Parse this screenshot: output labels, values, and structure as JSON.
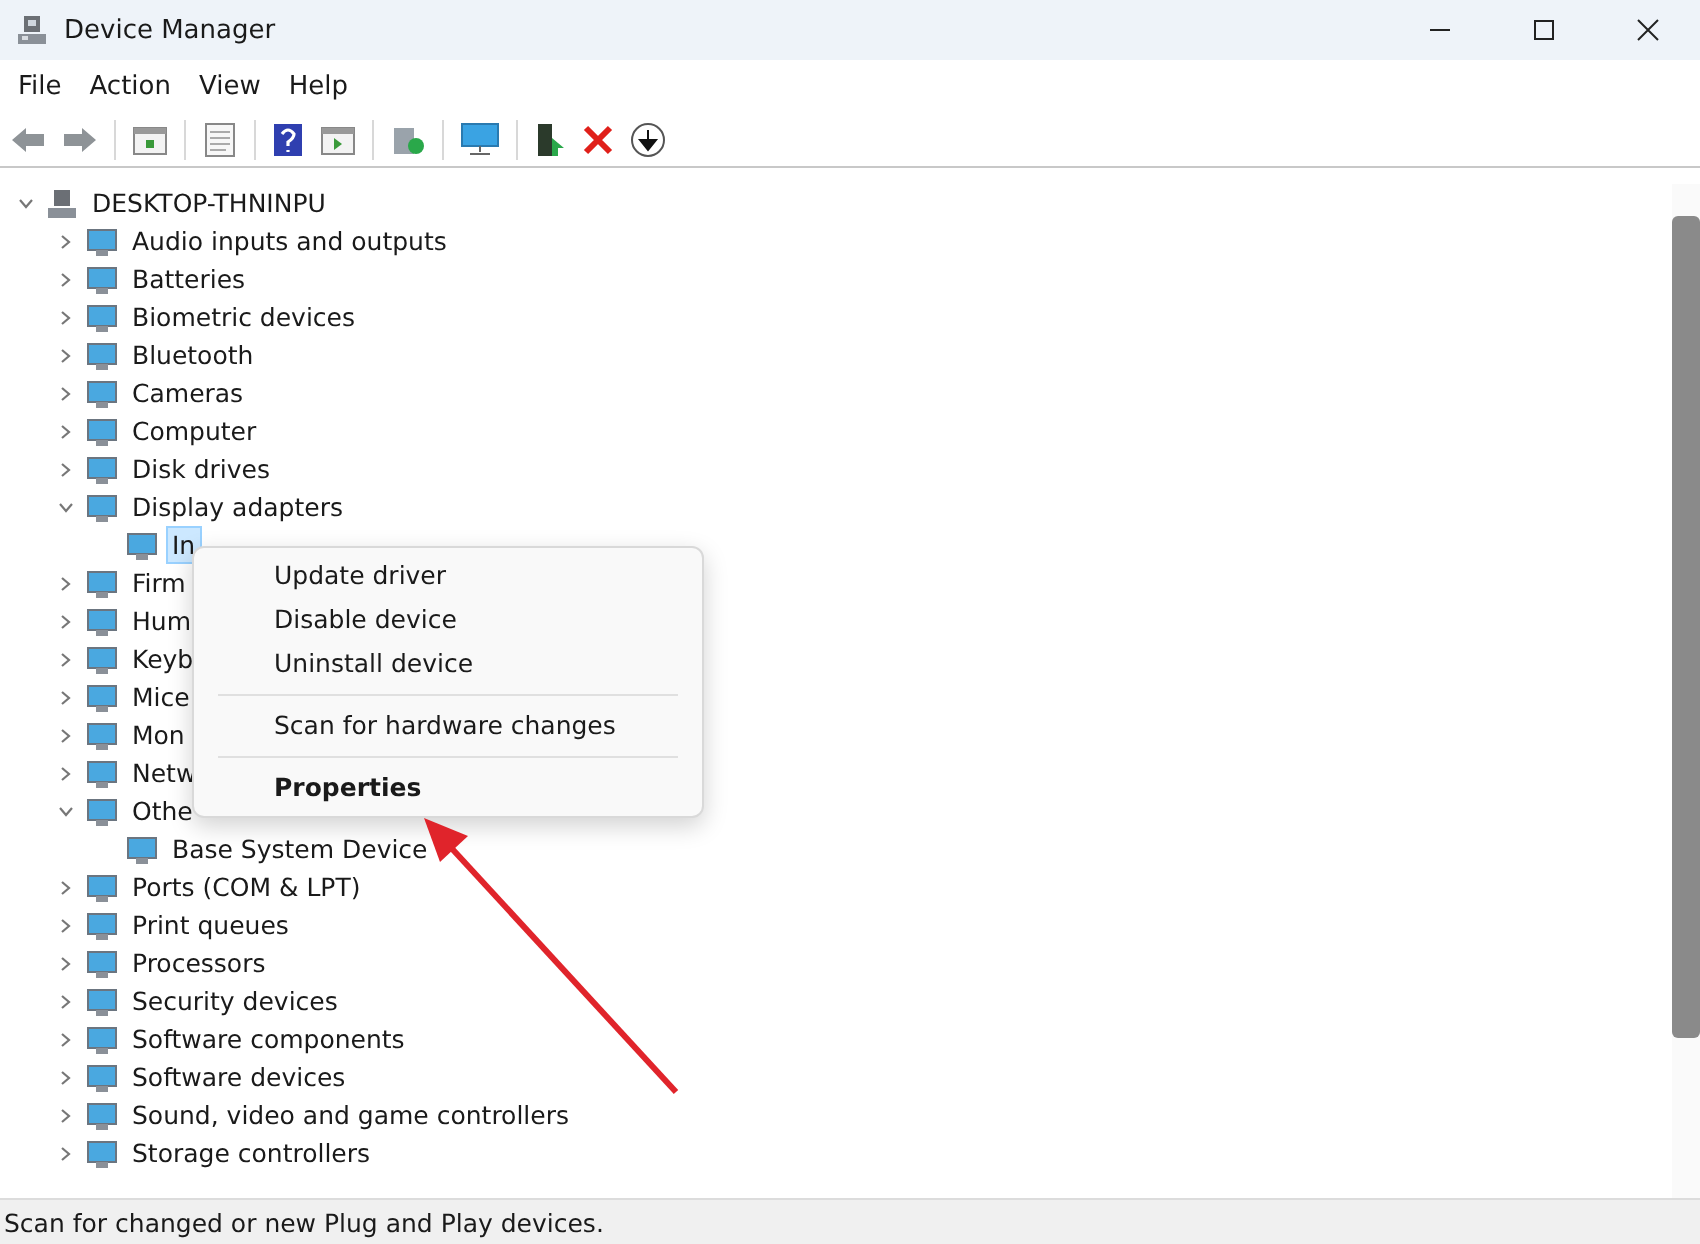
{
  "window": {
    "title": "Device Manager"
  },
  "menu_bar": [
    "File",
    "Action",
    "View",
    "Help"
  ],
  "tree": {
    "label": "DESKTOP-THNINPU",
    "expanded": true,
    "children": [
      {
        "label": "Audio inputs and outputs",
        "expanded": false
      },
      {
        "label": "Batteries",
        "expanded": false
      },
      {
        "label": "Biometric devices",
        "expanded": false
      },
      {
        "label": "Bluetooth",
        "expanded": false
      },
      {
        "label": "Cameras",
        "expanded": false
      },
      {
        "label": "Computer",
        "expanded": false
      },
      {
        "label": "Disk drives",
        "expanded": false
      },
      {
        "label": "Display adapters",
        "expanded": true,
        "children": [
          {
            "label": "In",
            "selected": true
          }
        ]
      },
      {
        "label": "Firm",
        "expanded": false
      },
      {
        "label": "Hum",
        "expanded": false
      },
      {
        "label": "Keyb",
        "expanded": false
      },
      {
        "label": "Mice",
        "expanded": false
      },
      {
        "label": "Mon",
        "expanded": false
      },
      {
        "label": "Netw",
        "expanded": false
      },
      {
        "label": "Othe",
        "expanded": true,
        "children": [
          {
            "label": "Base System Device",
            "selected": false
          }
        ]
      },
      {
        "label": "Ports (COM & LPT)",
        "expanded": false
      },
      {
        "label": "Print queues",
        "expanded": false
      },
      {
        "label": "Processors",
        "expanded": false
      },
      {
        "label": "Security devices",
        "expanded": false
      },
      {
        "label": "Software components",
        "expanded": false
      },
      {
        "label": "Software devices",
        "expanded": false
      },
      {
        "label": "Sound, video and game controllers",
        "expanded": false
      },
      {
        "label": "Storage controllers",
        "expanded": false
      }
    ]
  },
  "context_menu": {
    "groups": [
      [
        {
          "label": "Update driver",
          "default": false
        },
        {
          "label": "Disable device",
          "default": false
        },
        {
          "label": "Uninstall device",
          "default": false
        }
      ],
      [
        {
          "label": "Scan for hardware changes",
          "default": false
        }
      ],
      [
        {
          "label": "Properties",
          "default": true
        }
      ]
    ]
  },
  "status_bar": "Scan for changed or new Plug and Play devices."
}
